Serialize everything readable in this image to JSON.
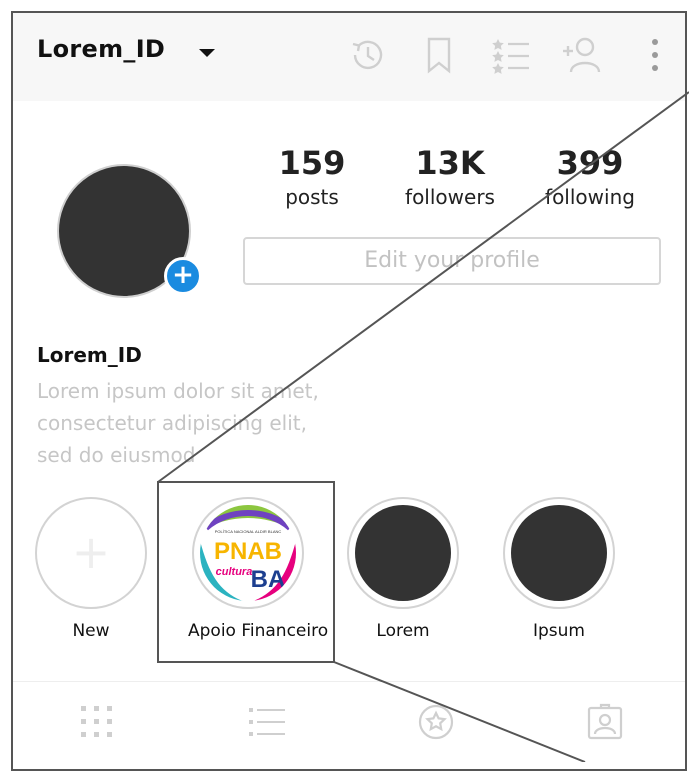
{
  "header": {
    "username": "Lorem_ID",
    "icons": [
      "history-icon",
      "bookmark-icon",
      "starred-list-icon",
      "add-person-icon",
      "more-vertical-icon"
    ]
  },
  "profile": {
    "add_badge": "+",
    "stats": [
      {
        "value": "159",
        "label": "posts"
      },
      {
        "value": "13K",
        "label": "followers"
      },
      {
        "value": "399",
        "label": "following"
      }
    ],
    "edit_button": "Edit your profile"
  },
  "bio": {
    "name": "Lorem_ID",
    "lines": [
      "Lorem ipsum dolor sit amet,",
      "consectetur adipiscing elit,",
      "sed do eiusmod"
    ]
  },
  "highlights": [
    {
      "label": "New"
    },
    {
      "label": "Apoio Financeiro"
    },
    {
      "label": "Lorem"
    },
    {
      "label": "Ipsum"
    }
  ],
  "logo": {
    "letters_top": "PNAB",
    "small_text": "POLÍTICA NACIONAL ALDIR BLANC",
    "word": "cultura",
    "letters_bottom": "BA"
  },
  "tabs": [
    "grid-icon",
    "list-icon",
    "star-icon",
    "tagged-person-icon"
  ],
  "colors": {
    "accent": "#1a8be0",
    "avatar": "#333333",
    "header_bg": "#f7f7f7",
    "muted_text": "#c6c6c6"
  }
}
